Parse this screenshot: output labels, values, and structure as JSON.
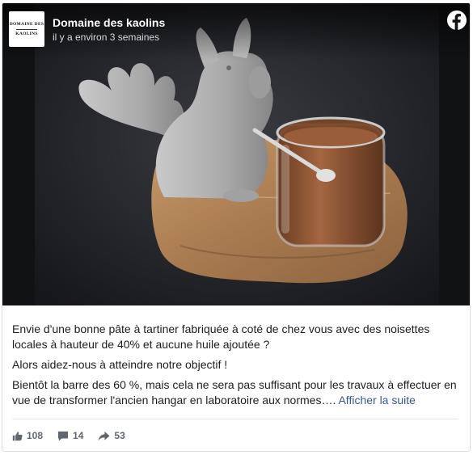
{
  "post": {
    "page_name": "Domaine des kaolins",
    "time_label": "il y a environ 3 semaines",
    "logo_line1": "DOMAINE DES",
    "logo_line2": "KAOLINS",
    "paragraphs": [
      "Envie d'une bonne pâte à tartiner fabriquée à coté de chez vous avec des noisettes locales à hauteur de 40% et aucune huile ajoutée ?",
      "Alors aidez-nous à atteindre notre objectif !",
      "Bientôt la barre des 60 %, mais cela ne sera pas suffisant pour les travaux à effectuer en vue de transformer l'ancien hangar en laboratoire aux normes…."
    ],
    "see_more": "Afficher la suite"
  },
  "stats": {
    "likes": "108",
    "comments": "14",
    "shares": "53"
  },
  "icons": {
    "network": "facebook-icon",
    "like": "thumbs-up-icon",
    "comment": "comment-bubble-icon",
    "share": "share-arrow-icon"
  },
  "colors": {
    "link": "#385898",
    "facebook_badge": "#ffffff",
    "stat_gray": "#606770"
  }
}
